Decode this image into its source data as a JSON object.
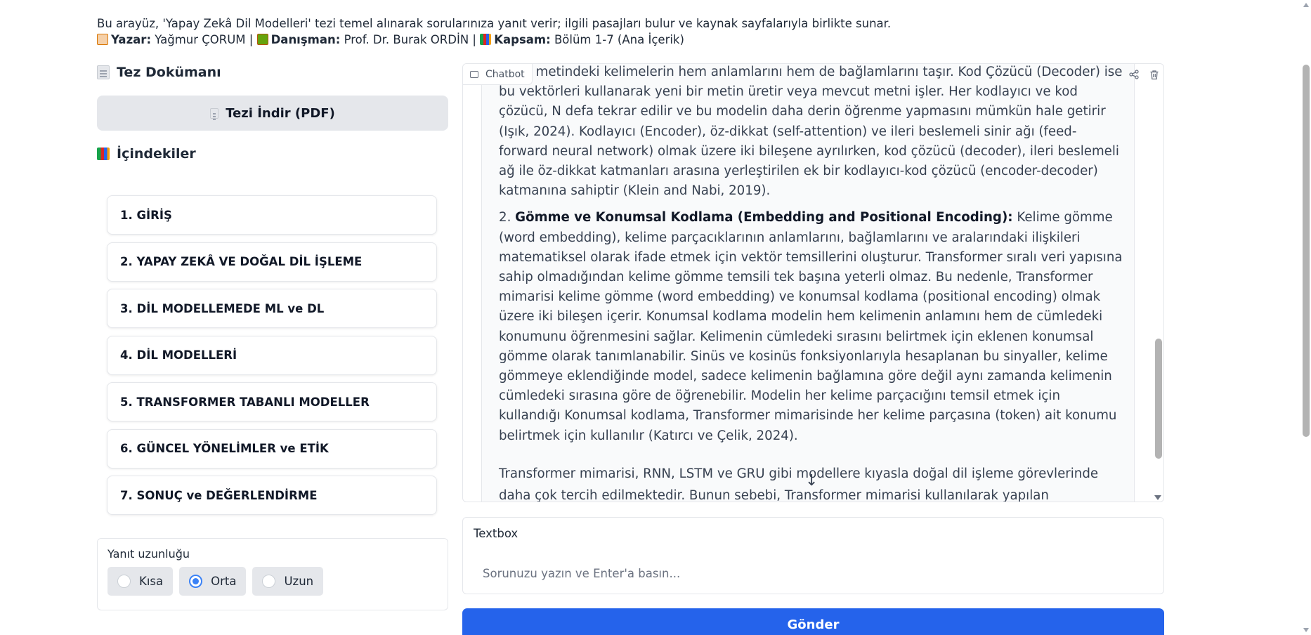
{
  "header": {
    "description": "Bu arayüz, 'Yapay Zekâ Dil Modelleri' tezi temel alınarak sorularınıza yanıt verir; ilgili pasajları bulur ve kaynak sayfalarıyla birlikte sunar.",
    "author_label": "Yazar:",
    "author": "Yağmur ÇORUM",
    "advisor_label": "Danışman:",
    "advisor": "Prof. Dr. Burak ORDİN",
    "scope_label": "Kapsam:",
    "scope": "Bölüm 1-7 (Ana İçerik)",
    "separator": "|"
  },
  "sidebar": {
    "doc_heading": "Tez Dokümanı",
    "download_label": "Tezi İndir (PDF)",
    "toc_heading": "İçindekiler",
    "toc": [
      "1. GİRİŞ",
      "2. YAPAY ZEKÂ VE DOĞAL DİL İŞLEME",
      "3. DİL MODELLEMEDE ML ve DL",
      "4. DİL MODELLERİ",
      "5. TRANSFORMER TABANLI MODELLER",
      "6. GÜNCEL YÖNELİMLER ve ETİK",
      "7. SONUÇ ve DEĞERLENDİRME"
    ],
    "length": {
      "label": "Yanıt uzunluğu",
      "options": [
        "Kısa",
        "Orta",
        "Uzun"
      ],
      "selected": "Orta"
    }
  },
  "chatbot": {
    "label": "Chatbot",
    "para1": "...ler, metindeki kelimelerin hem anlamlarını hem de bağlamlarını taşır. Kod Çözücü (Decoder) ise bu vektörleri kullanarak yeni bir metin üretir veya mevcut metni işler. Her kodlayıcı ve kod çözücü, N defa tekrar edilir ve bu modelin daha derin öğrenme yapmasını mümkün hale getirir (Işık, 2024). Kodlayıcı (Encoder), öz-dikkat (self-attention) ve ileri beslemeli sinir ağı (feed-forward neural network) olmak üzere iki bileşene ayrılırken, kod çözücü (decoder), ileri beslemeli ağ ile öz-dikkat katmanları arasına yerleştirilen ek bir kodlayıcı-kod çözücü (encoder-decoder) katmanına sahiptir (Klein and Nabi, 2019).",
    "para2_num": "2.",
    "para2_bold": "Gömme ve Konumsal Kodlama (Embedding and Positional Encoding):",
    "para2_text": " Kelime gömme (word embedding), kelime parçacıklarının anlamlarını, bağlamlarını ve aralarındaki ilişkileri matematiksel olarak ifade etmek için vektör temsillerini oluşturur. Transformer sıralı veri yapısına sahip olmadığından kelime gömme temsili tek başına yeterli olmaz. Bu nedenle, Transformer mimarisi kelime gömme (word embedding) ve konumsal kodlama (positional encoding) olmak üzere iki bileşen içerir. Konumsal kodlama modelin hem kelimenin anlamını hem de cümledeki konumunu öğrenmesini sağlar. Kelimenin cümledeki sırasını belirtmek için eklenen konumsal gömme olarak tanımlanabilir. Sinüs ve kosinüs fonksiyonlarıyla hesaplanan bu sinyaller, kelime gömmeye eklendiğinde model, sadece kelimenin bağlamına göre değil aynı zamanda kelimenin cümledeki sırasına göre de öğrenebilir. Modelin her kelime parçacığını temsil etmek için kullandığı Konumsal kodlama, Transformer mimarisinde her kelime parçasına (token) ait konumu belirtmek için kullanılır (Katırcı ve Çelik, 2024).",
    "para3": "Transformer mimarisi, RNN, LSTM ve GRU gibi modellere kıyasla doğal dil işleme görevlerinde daha çok tercih edilmektedir. Bunun sebebi, Transformer mimarisi kullanılarak yapılan"
  },
  "textbox": {
    "label": "Textbox",
    "placeholder": "Sorunuzu yazın ve Enter'a basın...",
    "value": ""
  },
  "send_label": "Gönder",
  "icons": {
    "author": "writing-hand-icon",
    "advisor": "teacher-icon",
    "scope": "books-icon",
    "doc": "page-icon",
    "chat": "chat-bubble-icon",
    "share": "share-icon",
    "trash": "trash-icon",
    "scroll": "arrow-down-icon"
  },
  "colors": {
    "primary": "#2563eb",
    "radio_accent": "#3b82f6",
    "neutral_button": "#e5e7eb"
  }
}
